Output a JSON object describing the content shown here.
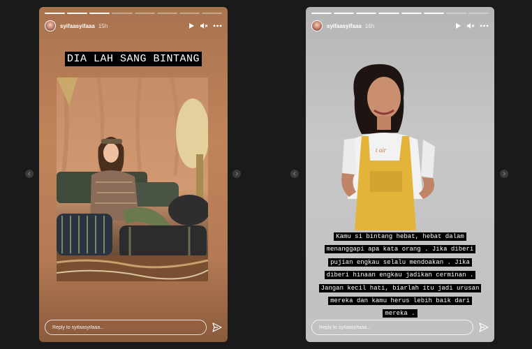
{
  "stories": [
    {
      "username": "syifaasyifaaa",
      "time": "15h",
      "progress": {
        "segments": 8,
        "completed": 3
      },
      "text": "DIA LAH SANG BINTANG",
      "reply_placeholder": "Reply to syifaasyifaaa..."
    },
    {
      "username": "syifaasyifaaa",
      "time": "16h",
      "progress": {
        "segments": 8,
        "completed": 6
      },
      "text": "Kamu si bintang hebat, hebat dalam menanggapi apa kata orang . Jika diberi pujian engkau selalu mendoakan . Jika diberi hinaan engkau jadikan cerminan . Jangan kecil hati, biarlah itu jadi urusan mereka dan kamu herus lebih baik dari mereka .",
      "reply_placeholder": "Reply to syifaasyifaaa..."
    }
  ],
  "icons": {
    "play": "play-icon",
    "mute": "volume-muted-icon",
    "more": "more-horizontal-icon",
    "send": "send-icon",
    "prev": "chevron-left-icon",
    "next": "chevron-right-icon"
  },
  "colors": {
    "page_bg": "#1a1a1a",
    "story1_bg": "#b47a55",
    "story2_bg": "#c1c1c1",
    "text_block_bg": "#000000",
    "overall_yellow": "#e3b33a"
  }
}
